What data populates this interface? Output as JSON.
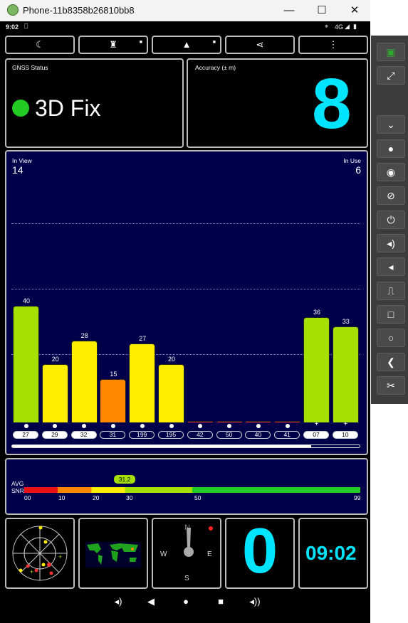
{
  "window": {
    "title": "Phone-11b8358b26810bb8",
    "minimize": "—",
    "maximize": "☐",
    "close": "✕"
  },
  "statusbar": {
    "time": "9:02",
    "network": "4G"
  },
  "gnss": {
    "label": "GNSS Status",
    "fix": "3D Fix",
    "fix_color": "#22cc22"
  },
  "accuracy": {
    "label": "Accuracy (± m)",
    "value": "8"
  },
  "sky": {
    "in_view_label": "In View",
    "in_view": "14",
    "in_use_label": "In Use",
    "in_use": "6"
  },
  "chart_data": {
    "type": "bar",
    "categories": [
      "27",
      "29",
      "32",
      "31",
      "199",
      "195",
      "42",
      "50",
      "40",
      "41",
      "07",
      "10"
    ],
    "values": [
      40,
      20,
      28,
      15,
      27,
      20,
      0,
      0,
      0,
      0,
      36,
      33
    ],
    "value_labels": [
      "40",
      "20",
      "28",
      "15",
      "27",
      "20",
      "",
      "",
      "",
      "",
      "36",
      "33"
    ],
    "colors": [
      "#a6e000",
      "#ffee00",
      "#ffee00",
      "#ff8800",
      "#ffee00",
      "#ffee00",
      "#ff3333",
      "#ff3333",
      "#ff3333",
      "#ff3333",
      "#a6e000",
      "#a6e000"
    ],
    "in_use": [
      true,
      true,
      true,
      false,
      false,
      false,
      false,
      false,
      false,
      false,
      true,
      true
    ],
    "markers": [
      "dot",
      "dot",
      "dot",
      "dot",
      "dot",
      "dot",
      "dot",
      "dot",
      "dot",
      "dot",
      "plus",
      "plus"
    ],
    "ylim": [
      0,
      50
    ]
  },
  "snr": {
    "avg_label": "AVG",
    "snr_label": "SNR",
    "avg_value": "31.2",
    "ticks": [
      "00",
      "10",
      "20",
      "30",
      "50",
      "99"
    ]
  },
  "widgets": {
    "compass_n": "N",
    "compass_e": "E",
    "compass_s": "S",
    "compass_w": "W",
    "count": "0",
    "clock": "09:02"
  }
}
